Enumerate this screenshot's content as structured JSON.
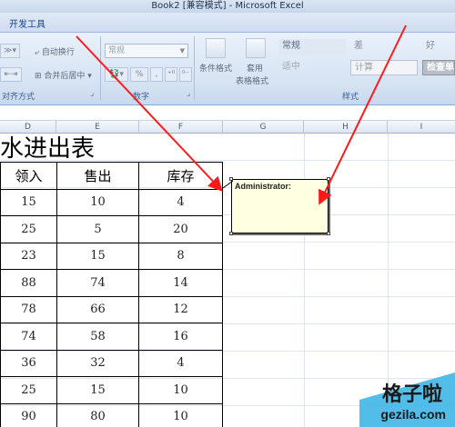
{
  "window": {
    "title": "Book2  [兼容模式] - Microsoft Excel"
  },
  "ribbon": {
    "tab_developer": "开发工具",
    "alignment": {
      "wrap_text": "自动换行",
      "merge_center": "合并后居中",
      "group_label": "对齐方式"
    },
    "number": {
      "format_value": "常规",
      "group_label": "数字",
      "percent": "%",
      "comma": ","
    },
    "styles": {
      "conditional_format": "条件格式",
      "format_as_table_1": "套用",
      "format_as_table_2": "表格格式",
      "normal": "常规",
      "bad": "差",
      "good": "好",
      "neutral": "适中",
      "calculation": "计算",
      "check_cell": "检查单",
      "group_label": "样式"
    }
  },
  "columns": [
    "D",
    "E",
    "F",
    "G",
    "H",
    "I"
  ],
  "sheet": {
    "title": "水进出表",
    "headers": [
      "领入",
      "售出",
      "库存"
    ],
    "rows": [
      [
        "15",
        "10",
        "4"
      ],
      [
        "25",
        "5",
        "20"
      ],
      [
        "23",
        "15",
        "8"
      ],
      [
        "88",
        "74",
        "14"
      ],
      [
        "78",
        "66",
        "12"
      ],
      [
        "74",
        "58",
        "16"
      ],
      [
        "36",
        "32",
        "4"
      ],
      [
        "25",
        "15",
        "10"
      ],
      [
        "90",
        "80",
        "10"
      ]
    ]
  },
  "comment": {
    "author": "Administrator:"
  },
  "watermark": {
    "brand": "格子啦",
    "domain": "gezila.com"
  },
  "colors": {
    "arrow": "#ff1a1a",
    "comment_bg": "#ffffe1",
    "ribbon_blue": "#d6e3f3"
  }
}
